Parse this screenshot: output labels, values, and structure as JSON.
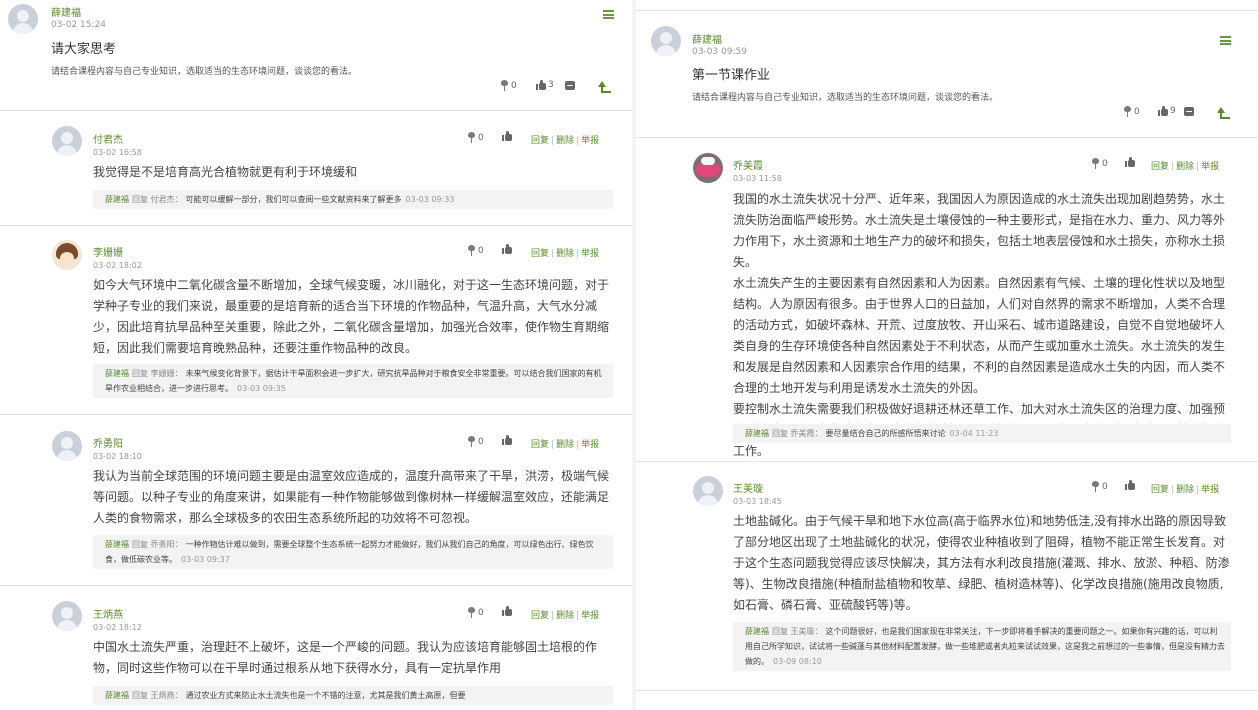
{
  "left": {
    "post": {
      "author": "薛建福",
      "time": "03-02 15:24",
      "title": "请大家思考",
      "description": "请结合课程内容与自己专业知识，选取适当的生态环境问题，谈谈您的看法。",
      "flowers": "0",
      "likes": "3",
      "menu_icon": "menu-icon"
    },
    "comments": [
      {
        "author": "付君杰",
        "time": "03-02 16:58",
        "flowers": "0",
        "body": "我觉得是不是培育高光合植物就更有利于环境缓和",
        "reply": {
          "name": "薛建福",
          "label": "回复 付君杰：",
          "text": "可能可以缓解一部分，我们可以查阅一些文献资料来了解更多",
          "time": "03-03 09:33"
        }
      },
      {
        "author": "李姗姗",
        "time": "03-02 18:02",
        "flowers": "0",
        "body": "如今大气环境中二氧化碳含量不断增加，全球气候变暖，冰川融化，对于这一生态环境问题，对于学种子专业的我们来说，最重要的是培育新的适合当下环境的作物品种，气温升高，大气水分减少，因此培育抗旱品种至关重要，除此之外，二氧化碳含量增加，加强光合效率，使作物生育期缩短，因此我们需要培育晚熟品种，还要注重作物品种的改良。",
        "reply": {
          "name": "薛建福",
          "label": "回复 李姗姗：",
          "text": "未来气候变化背景下，据估计干旱面积会进一步扩大，研究抗旱品种对于粮食安全非常重要。可以结合我们国家的有机旱作农业相结合，进一步进行思考。",
          "time": "03-03 09:35"
        }
      },
      {
        "author": "乔勇阳",
        "time": "03-02 18:10",
        "flowers": "0",
        "body": "我认为当前全球范围的环境问题主要是由温室效应造成的，温度升高带来了干旱，洪涝，极端气候等问题。以种子专业的角度来讲，如果能有一种作物能够做到像树林一样缓解温室效应，还能满足人类的食物需求，那么全球极多的农田生态系统所起的功效将不可忽视。",
        "reply": {
          "name": "薛建福",
          "label": "回复 乔勇阳：",
          "text": "一种作物估计难以做到，需要全球整个生态系统一起努力才能做好，我们从我们自己的角度，可以绿色出行、绿色饮食，做低碳农业等。",
          "time": "03-03 09:37"
        }
      },
      {
        "author": "王炳燕",
        "time": "03-02 18:12",
        "flowers": "0",
        "body": "中国水土流失严重，治理赶不上破坏，这是一个严峻的问题。我认为应该培育能够固土培根的作物，同时这些作物可以在干旱时通过根系从地下获得水分，具有一定抗旱作用",
        "reply": {
          "name": "薛建福",
          "label": "回复 王炳燕：",
          "text": "通过农业方式来防止水土流失也是一个不错的注意，尤其是我们黄土高原，但要",
          "time": ""
        }
      }
    ]
  },
  "right": {
    "post": {
      "author": "薛建福",
      "time": "03-03 09:59",
      "title": "第一节课作业",
      "description": "请结合课程内容与自己专业知识，选取适当的生态环境问题，谈谈您的看法。",
      "flowers": "0",
      "likes": "9",
      "menu_icon": "menu-icon"
    },
    "comments": [
      {
        "author": "乔美霞",
        "time": "03-03 11:58",
        "flowers": "0",
        "body_paragraphs": [
          "我国的水土流失状况十分严、近年来，我国因人为原因造成的水土流失出现加剧趋势势，水土流失防治面临严峻形势。水土流失是土壤侵蚀的一种主要形式，是指在水力、重力、风力等外力作用下，水土资源和土地生产力的破坏和损失，包括土地表层侵蚀和水土损失，亦称水土损失。",
          "水土流失产生的主要因素有自然因素和人为因素。自然因素有气候、土壤的理化性状以及地型结构。人为原因有很多。由于世界人口的日益加，人们对自然界的需求不断增加，人类不合理的活动方式，如破坏森林、开荒、过度放牧、开山采石、城市道路建设，自觉不自觉地破坏人类自身的生存环境使各种自然因素处于不利状态，从而产生或加重水土流失。水土流失的发生和发展是自然因素和人因素宗合作用的结果，不利的自然因素是造成水土失的内因，而人类不合理的土地开发与利用是诱发水土流失的外因。",
          "要控制水土流失需要我们积极做好退耕还林还草工作、加大对水土流失区的治理力度、加强预警系统建设，加大监管力度、建立稳定的投入保障机制、开展各项水土保持的科研和技术推广工作。"
        ],
        "reply": {
          "name": "薛建福",
          "label": "回复 乔美霞：",
          "text": "要尽量结合自己的所感所悟来讨论",
          "time": "03-04 11:23"
        }
      },
      {
        "author": "王美璇",
        "time": "03-03 18:45",
        "flowers": "0",
        "body": "土地盐碱化。由于气候干旱和地下水位高(高于临界水位)和地势低洼,没有排水出路的原因导致了部分地区出现了土地盐碱化的状况，使得农业种植收到了阻碍，植物不能正常生长发育。对于这个生态问题我觉得应该尽快解决，其方法有水利改良措施(灌溉、排水、放淤、种稻、防渗等)、生物改良措施(种植耐盐植物和牧草、绿肥、植树造林等)、化学改良措施(施用改良物质,如石膏、磷石膏、亚硫酸钙等)等。",
        "reply": {
          "name": "薛建福",
          "label": "回复 王美璇：",
          "text": "这个问题很好，也是我们国家现在非常关注，下一步即将着手解决的重要问题之一。如果你有兴趣的话，可以利用自己所学知识，试试将一些碱蓬与其他材料配置发酵，做一些堆肥或者丸粒来试试效果，这是我之前想过的一些事情，但是没有精力去做的。",
          "time": "03-09 08:10"
        }
      }
    ]
  },
  "actions": {
    "reply": "回复",
    "delete": "删除",
    "report": "举报",
    "sep": "|"
  }
}
